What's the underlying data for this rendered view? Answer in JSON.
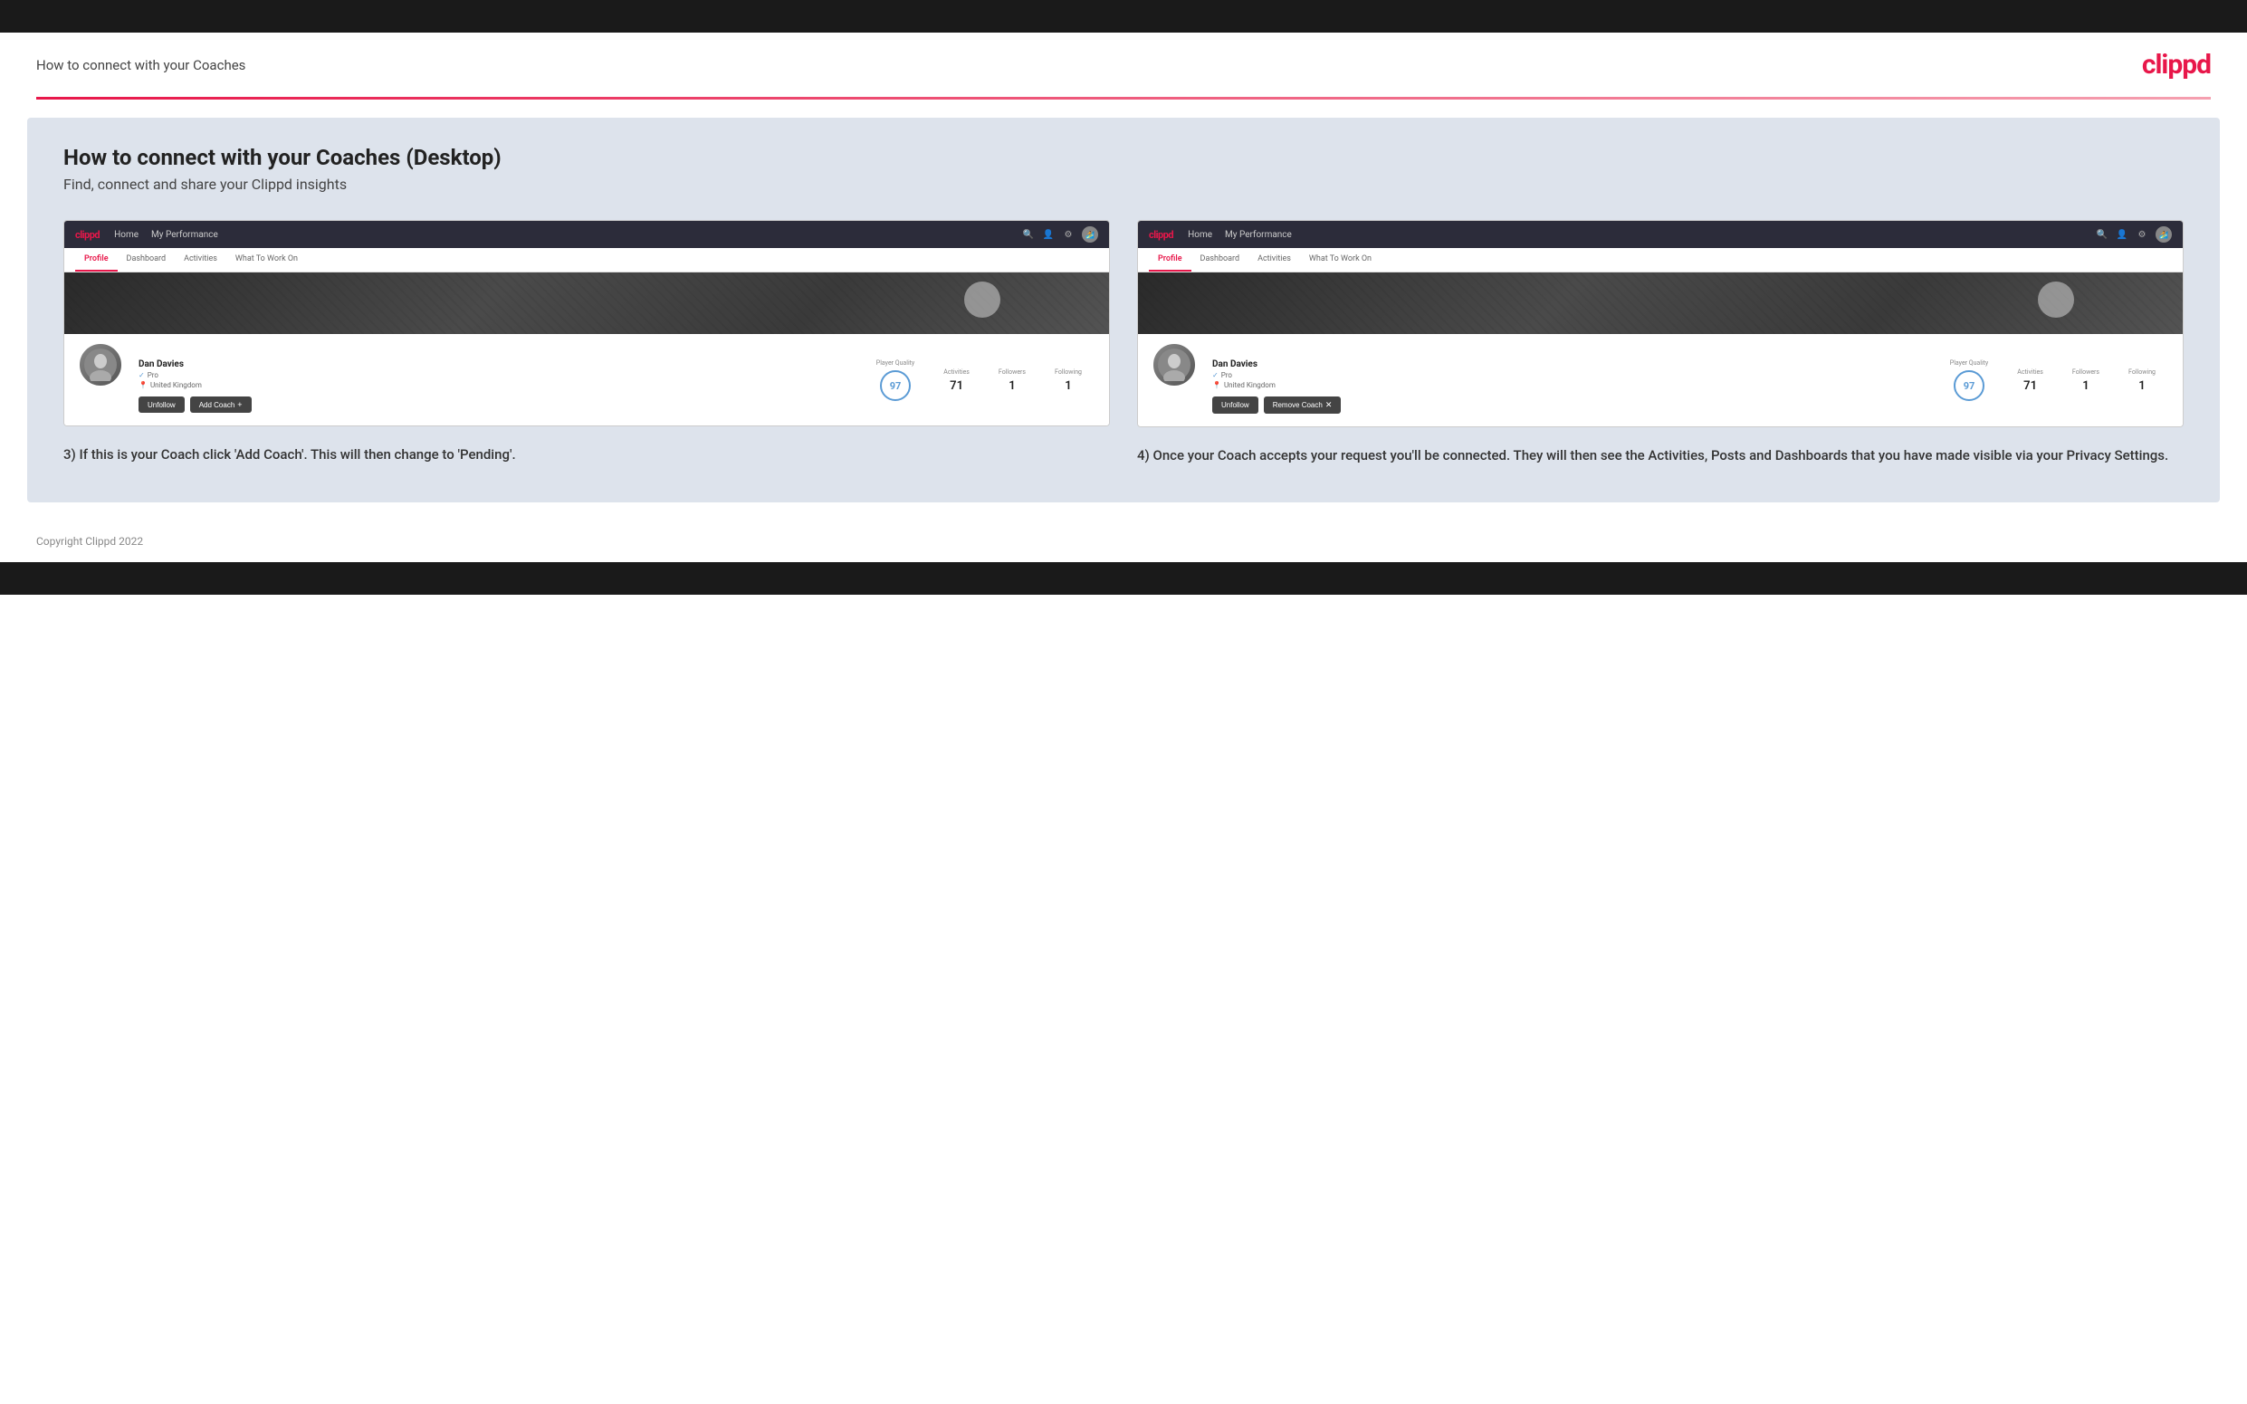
{
  "header": {
    "title": "How to connect with your Coaches",
    "logo": "clippd"
  },
  "main": {
    "heading": "How to connect with your Coaches (Desktop)",
    "subheading": "Find, connect and share your Clippd insights",
    "screenshots": [
      {
        "id": "screenshot-left",
        "nav": {
          "logo": "clippd",
          "items": [
            "Home",
            "My Performance"
          ],
          "icons": [
            "search",
            "user",
            "settings",
            "avatar"
          ]
        },
        "tabs": [
          {
            "label": "Profile",
            "active": true
          },
          {
            "label": "Dashboard",
            "active": false
          },
          {
            "label": "Activities",
            "active": false
          },
          {
            "label": "What To Work On",
            "active": false
          }
        ],
        "profile": {
          "name": "Dan Davies",
          "role": "Pro",
          "location": "United Kingdom",
          "player_quality": "97",
          "activities": "71",
          "followers": "1",
          "following": "1"
        },
        "buttons": [
          "Unfollow",
          "Add Coach +"
        ]
      },
      {
        "id": "screenshot-right",
        "nav": {
          "logo": "clippd",
          "items": [
            "Home",
            "My Performance"
          ],
          "icons": [
            "search",
            "user",
            "settings",
            "avatar"
          ]
        },
        "tabs": [
          {
            "label": "Profile",
            "active": true
          },
          {
            "label": "Dashboard",
            "active": false
          },
          {
            "label": "Activities",
            "active": false
          },
          {
            "label": "What To Work On",
            "active": false
          }
        ],
        "profile": {
          "name": "Dan Davies",
          "role": "Pro",
          "location": "United Kingdom",
          "player_quality": "97",
          "activities": "71",
          "followers": "1",
          "following": "1"
        },
        "buttons": [
          "Unfollow",
          "Remove Coach ×"
        ]
      }
    ],
    "descriptions": [
      "3) If this is your Coach click 'Add Coach'. This will then change to 'Pending'.",
      "4) Once your Coach accepts your request you'll be connected. They will then see the Activities, Posts and Dashboards that you have made visible via your Privacy Settings."
    ]
  },
  "footer": {
    "copyright": "Copyright Clippd 2022"
  }
}
